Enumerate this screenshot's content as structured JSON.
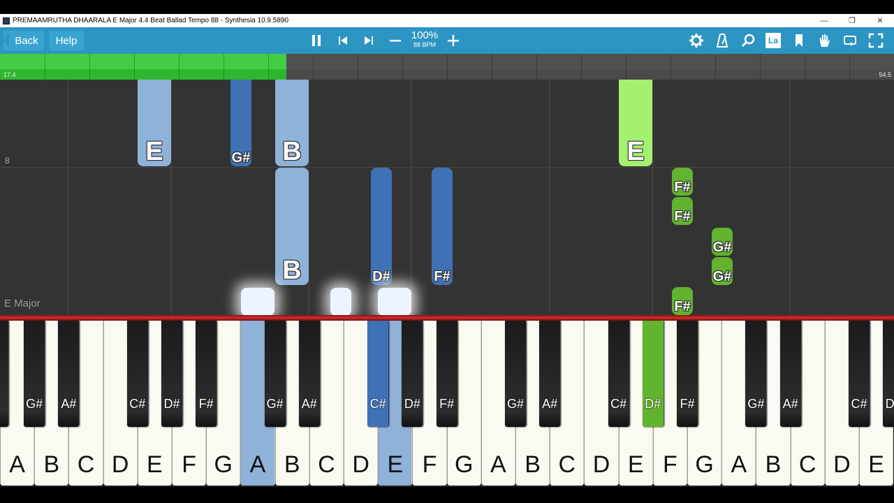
{
  "window": {
    "title": "PREMAAMRUTHA DHAARALA E Major 4.4 Beat Ballad Tempo 88 - Synthesia 10.9.5890",
    "minimize": "—",
    "restore": "❐",
    "close": "✕"
  },
  "toolbar": {
    "back_label": "Back",
    "help_label": "Help",
    "speed_percent": "100%",
    "speed_bpm": "88 BPM",
    "lyrics_label": "La",
    "icons": [
      "pause-icon",
      "skip-back-icon",
      "skip-forward-icon",
      "minus-icon",
      "plus-icon",
      "gear-icon",
      "metronome-icon",
      "search-icon",
      "lyrics-icon",
      "bookmark-icon",
      "hand-icon",
      "loop-icon",
      "fullscreen-icon"
    ]
  },
  "timeline": {
    "start_label": "17.4",
    "end_label": "54.5",
    "progress_fraction": 0.32
  },
  "roll": {
    "measure_number": "8",
    "key_signature": "E Major"
  },
  "notes": [
    {
      "label": "E"
    },
    {
      "label": "G#"
    },
    {
      "label": "B"
    },
    {
      "label": "B"
    },
    {
      "label": "D#"
    },
    {
      "label": "F#"
    },
    {
      "label": "E"
    },
    {
      "label": "F#"
    },
    {
      "label": "F#"
    },
    {
      "label": "G#"
    },
    {
      "label": "G#"
    },
    {
      "label": "F#"
    },
    {
      "label": ""
    },
    {
      "label": ""
    },
    {
      "label": ""
    }
  ],
  "white_keys": [
    "A",
    "B",
    "C",
    "D",
    "E",
    "F",
    "G",
    "A",
    "B",
    "C",
    "D",
    "E",
    "F",
    "G",
    "A",
    "B",
    "C",
    "D",
    "E",
    "F",
    "G",
    "A",
    "B",
    "C",
    "D",
    "E"
  ],
  "black_keys": [
    "G#",
    "A#",
    "C#",
    "D#",
    "F#",
    "G#",
    "A#",
    "C#",
    "D#",
    "F#",
    "G#",
    "A#",
    "C#",
    "D#",
    "F#",
    "G#",
    "A#",
    "C#",
    "D#"
  ],
  "colors": {
    "toolbar": "#2c95c2",
    "progress": "#2fb630",
    "left_hand_light": "#8fb2d8",
    "left_hand_dark": "#3f72b5",
    "right_hand_light": "#a4f070",
    "right_hand_dark": "#62b32f"
  }
}
